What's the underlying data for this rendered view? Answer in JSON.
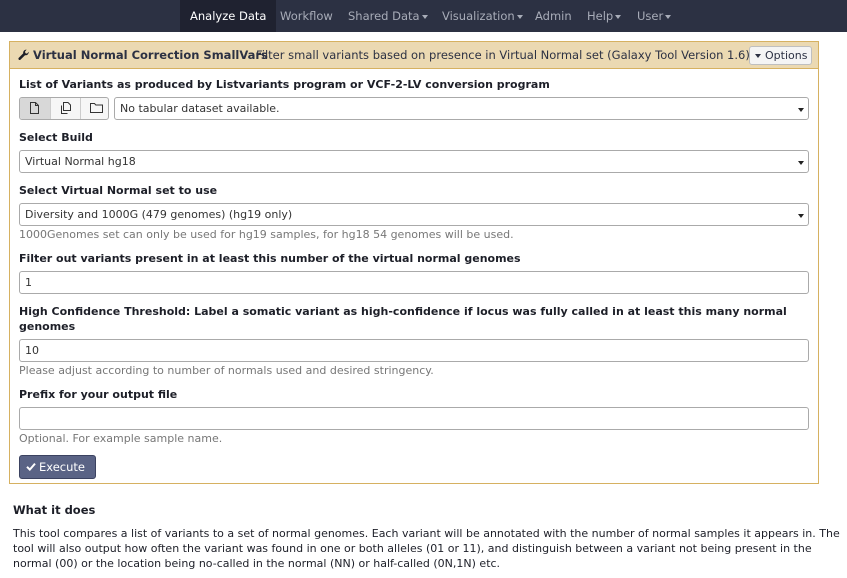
{
  "nav": {
    "items": [
      {
        "label": "Analyze Data",
        "active": true,
        "dropdown": false
      },
      {
        "label": "Workflow",
        "active": false,
        "dropdown": false
      },
      {
        "label": "Shared Data",
        "active": false,
        "dropdown": true
      },
      {
        "label": "Visualization",
        "active": false,
        "dropdown": true
      },
      {
        "label": "Admin",
        "active": false,
        "dropdown": false
      },
      {
        "label": "Help",
        "active": false,
        "dropdown": true
      },
      {
        "label": "User",
        "active": false,
        "dropdown": true
      }
    ]
  },
  "tool": {
    "title": "Virtual Normal Correction SmallVars",
    "description": "Filter small variants based on presence in Virtual Normal set (Galaxy Tool Version 1.6)",
    "options_label": "Options",
    "icon": "wrench-icon"
  },
  "form": {
    "variants_list": {
      "label": "List of Variants as produced by Listvariants program or VCF-2-LV conversion program",
      "value": "No tabular dataset available.",
      "source_buttons": [
        "file-icon",
        "files-icon",
        "folder-icon"
      ]
    },
    "build": {
      "label": "Select Build",
      "value": "Virtual Normal hg18"
    },
    "vn_set": {
      "label": "Select Virtual Normal set to use",
      "value": "Diversity and 1000G (479 genomes) (hg19 only)",
      "help": "1000Genomes set can only be used for hg19 samples, for hg18 54 genomes will be used."
    },
    "filter_threshold": {
      "label": "Filter out variants present in at least this number of the virtual normal genomes",
      "value": "1"
    },
    "high_confidence": {
      "label_line1": "High Confidence Threshold: Label a somatic variant as high-confidence if locus was fully called in at least this many normal",
      "label_line2": "genomes",
      "value": "10",
      "help": "Please adjust according to number of normals used and desired stringency."
    },
    "prefix": {
      "label": "Prefix for your output file",
      "value": "",
      "help": "Optional. For example sample name."
    },
    "execute_label": "Execute"
  },
  "help_section": {
    "title": "What it does",
    "lines": [
      "This tool compares a list of variants to a set of normal genomes. Each variant will be annotated with the number of normal samples it appears in. The",
      "tool will also output how often the variant was found in one or both alleles (01 or 11), and distinguish between a variant not being present in the",
      "normal (00) or the location being no-called in the normal (NN) or half-called (0N,1N) etc."
    ]
  },
  "colors": {
    "navbar": "#2c3143",
    "panel_header": "#ebd9b2",
    "panel_border": "#d6b161",
    "execute_button": "#5a6385"
  }
}
